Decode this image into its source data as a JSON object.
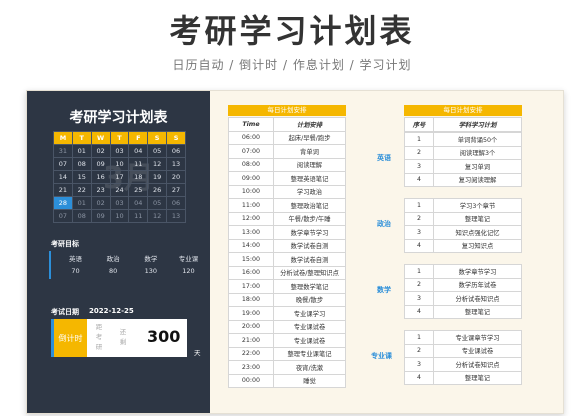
{
  "header": {
    "title": "考研学习计划表",
    "subtitle": "日历自动 / 倒计时 / 作息计划 / 学习计划"
  },
  "sidebar": {
    "title": "考研学习计划表",
    "calendar": {
      "weekdays": [
        "M",
        "T",
        "W",
        "T",
        "F",
        "S",
        "S"
      ],
      "weeks": [
        [
          "31",
          "01",
          "02",
          "03",
          "04",
          "05",
          "06"
        ],
        [
          "07",
          "08",
          "09",
          "10",
          "11",
          "12",
          "13"
        ],
        [
          "14",
          "15",
          "16",
          "17",
          "18",
          "19",
          "20"
        ],
        [
          "21",
          "22",
          "23",
          "24",
          "25",
          "26",
          "27"
        ],
        [
          "28",
          "01",
          "02",
          "03",
          "04",
          "05",
          "06"
        ],
        [
          "07",
          "08",
          "09",
          "10",
          "11",
          "12",
          "13"
        ]
      ],
      "today": "28",
      "month_watermark": "3月"
    },
    "goals": {
      "label": "考研目标",
      "subjects": [
        "英语",
        "政治",
        "数学",
        "专业课"
      ],
      "scores": [
        "70",
        "80",
        "130",
        "120"
      ]
    },
    "exam": {
      "label": "考试日期",
      "date": "2022-12-25",
      "countdown_label": "倒计时",
      "col1": [
        "距",
        "考",
        "研"
      ],
      "col2": [
        "还",
        "剩"
      ],
      "days_left": "300",
      "days_unit": "天"
    }
  },
  "daily": {
    "header": "每日计划安排",
    "col_time": "Time",
    "col_plan": "计划安排",
    "rows": [
      {
        "time": "06:00",
        "plan": "起床/早餐/跑步"
      },
      {
        "time": "07:00",
        "plan": "背单词"
      },
      {
        "time": "08:00",
        "plan": "阅读理解"
      },
      {
        "time": "09:00",
        "plan": "整理英语笔记"
      },
      {
        "time": "10:00",
        "plan": "学习政治"
      },
      {
        "time": "11:00",
        "plan": "整理政治笔记"
      },
      {
        "time": "12:00",
        "plan": "午餐/散步/午睡"
      },
      {
        "time": "13:00",
        "plan": "数学章节学习"
      },
      {
        "time": "14:00",
        "plan": "数学试卷自测"
      },
      {
        "time": "15:00",
        "plan": "数学试卷自测"
      },
      {
        "time": "16:00",
        "plan": "分析试卷/整理知识点"
      },
      {
        "time": "17:00",
        "plan": "整理数学笔记"
      },
      {
        "time": "18:00",
        "plan": "晚餐/散步"
      },
      {
        "time": "19:00",
        "plan": "专业课学习"
      },
      {
        "time": "20:00",
        "plan": "专业课试卷"
      },
      {
        "time": "21:00",
        "plan": "专业课试卷"
      },
      {
        "time": "22:00",
        "plan": "整理专业课笔记"
      },
      {
        "time": "23:00",
        "plan": "夜宵/洗漱"
      },
      {
        "time": "00:00",
        "plan": "睡觉"
      }
    ]
  },
  "study": {
    "header": "每日计划安排",
    "col_no": "序号",
    "col_plan": "学科学习计划",
    "groups": [
      {
        "subject": "英语",
        "rows": [
          {
            "no": "1",
            "plan": "单词背诵50个"
          },
          {
            "no": "2",
            "plan": "阅读理解3个"
          },
          {
            "no": "3",
            "plan": "复习单词"
          },
          {
            "no": "4",
            "plan": "复习阅读理解"
          }
        ]
      },
      {
        "subject": "政治",
        "rows": [
          {
            "no": "1",
            "plan": "学习3个章节"
          },
          {
            "no": "2",
            "plan": "整理笔记"
          },
          {
            "no": "3",
            "plan": "知识点强化记忆"
          },
          {
            "no": "4",
            "plan": "复习知识点"
          }
        ]
      },
      {
        "subject": "数学",
        "rows": [
          {
            "no": "1",
            "plan": "数学章节学习"
          },
          {
            "no": "2",
            "plan": "数学历年试卷"
          },
          {
            "no": "3",
            "plan": "分析试卷知识点"
          },
          {
            "no": "4",
            "plan": "整理笔记"
          }
        ]
      },
      {
        "subject": "专业课",
        "rows": [
          {
            "no": "1",
            "plan": "专业课章节学习"
          },
          {
            "no": "2",
            "plan": "专业课试卷"
          },
          {
            "no": "3",
            "plan": "分析试卷知识点"
          },
          {
            "no": "4",
            "plan": "整理笔记"
          }
        ]
      }
    ]
  },
  "colors": {
    "accent_yellow": "#f5b700",
    "accent_blue": "#2c8fd9",
    "panel_dark": "#2d3644"
  }
}
